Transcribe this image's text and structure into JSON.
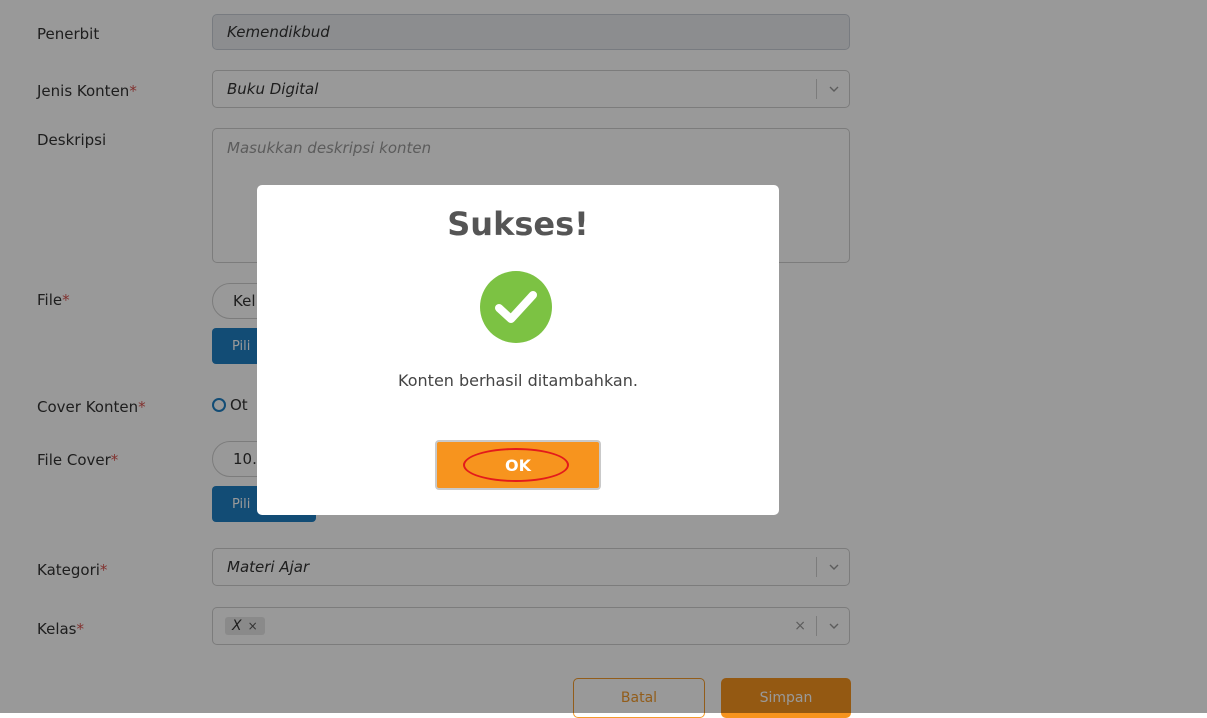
{
  "form": {
    "penerbit": {
      "label": "Penerbit",
      "value": "Kemendikbud"
    },
    "jenis_konten": {
      "label": "Jenis Konten",
      "req": "*",
      "value": "Buku Digital"
    },
    "deskripsi": {
      "label": "Deskripsi",
      "placeholder": "Masukkan deskripsi konten"
    },
    "file": {
      "label": "File",
      "req": "*",
      "pill_text": "Kel",
      "button": "Pili"
    },
    "cover_konten": {
      "label": "Cover Konten",
      "req": "*",
      "radio_label": "Ot"
    },
    "file_cover": {
      "label": "File Cover",
      "req": "*",
      "pill_text": "10.",
      "button": "Pili"
    },
    "kategori": {
      "label": "Kategori",
      "req": "*",
      "value": "Materi Ajar"
    },
    "kelas": {
      "label": "Kelas",
      "req": "*",
      "tag": "X",
      "tag_remove": "×",
      "clear": "×"
    },
    "actions": {
      "cancel": "Batal",
      "save": "Simpan"
    }
  },
  "modal": {
    "title": "Sukses!",
    "icon": "check-circle-icon",
    "message": "Konten berhasil ditambahkan.",
    "ok_label": "OK"
  },
  "colors": {
    "accent_orange": "#f7941e",
    "primary_blue": "#1f7fc4",
    "success_green": "#7cc243",
    "required_red": "#d9534f",
    "highlight_ring": "#e31b1b"
  }
}
